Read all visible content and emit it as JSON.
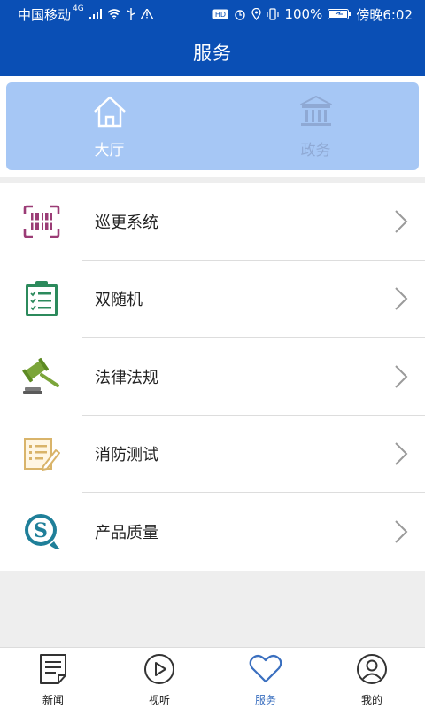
{
  "status_bar": {
    "carrier": "中国移动",
    "network": "4G",
    "battery": "100%",
    "time": "傍晚6:02"
  },
  "header": {
    "title": "服务"
  },
  "tabs": [
    {
      "label": "大厅",
      "icon": "home-icon",
      "active": true
    },
    {
      "label": "政务",
      "icon": "bank-icon",
      "active": false
    }
  ],
  "services": [
    {
      "label": "巡更系统",
      "icon": "patrol-barcode-icon",
      "color": "#9b3c76"
    },
    {
      "label": "双随机",
      "icon": "clipboard-checklist-icon",
      "color": "#2c8a5c"
    },
    {
      "label": "法律法规",
      "icon": "gavel-icon",
      "color": "#7ba53a"
    },
    {
      "label": "消防测试",
      "icon": "document-edit-icon",
      "color": "#d9b46a"
    },
    {
      "label": "产品质量",
      "icon": "quality-s-icon",
      "color": "#1f7f99"
    }
  ],
  "bottom_nav": [
    {
      "label": "新闻",
      "icon": "news-icon",
      "active": false
    },
    {
      "label": "视听",
      "icon": "play-icon",
      "active": false
    },
    {
      "label": "服务",
      "icon": "heart-icon",
      "active": true
    },
    {
      "label": "我的",
      "icon": "user-icon",
      "active": false
    }
  ],
  "colors": {
    "primary": "#0a4fb5",
    "tab_background": "#a6c7f5",
    "nav_active": "#3a6fbf"
  }
}
